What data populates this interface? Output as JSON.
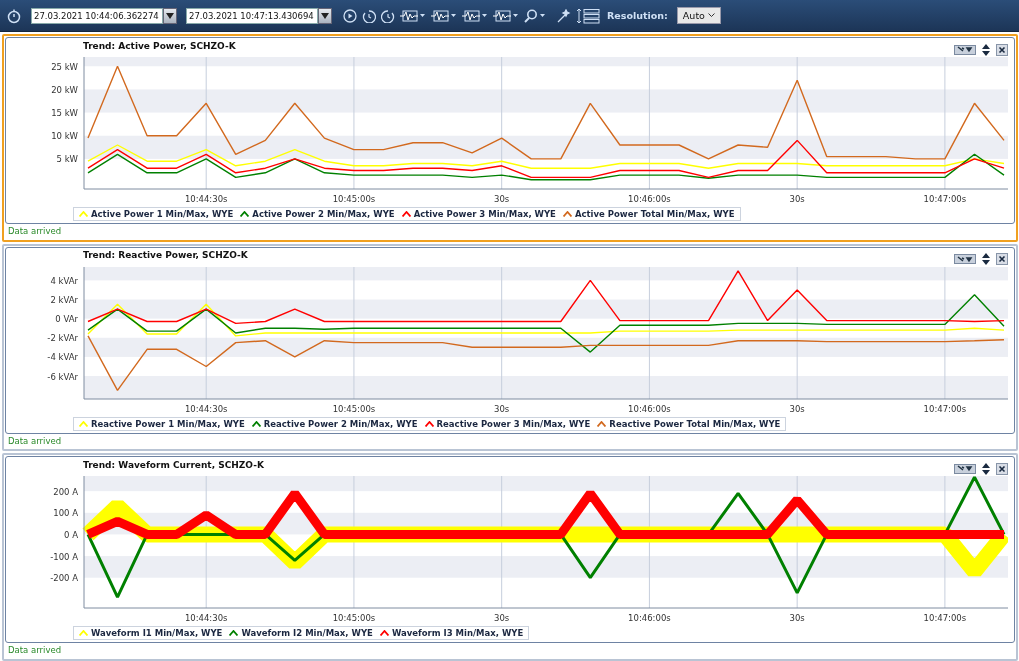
{
  "toolbar": {
    "start_time": "27.03.2021 10:44:06.362274",
    "end_time": "27.03.2021 10:47:13.430694",
    "resolution_label": "Resolution:",
    "resolution": "Auto"
  },
  "panels": [
    {
      "title": "Trend: Active Power, SCHZO-K",
      "selected": true,
      "kind": "trend",
      "status": "Data arrived",
      "chart_data": {
        "type": "line",
        "categories": [
          null,
          null,
          null,
          null,
          "10:44:30s",
          null,
          null,
          null,
          null,
          "10:45:00s",
          null,
          null,
          null,
          null,
          "30s",
          null,
          null,
          null,
          null,
          "10:46:00s",
          null,
          null,
          null,
          null,
          "30s",
          null,
          null,
          null,
          null,
          "10:47:00s",
          null,
          null
        ],
        "ylim": [
          -1.5,
          27
        ],
        "grid": true,
        "yticks": [
          {
            "value": 5,
            "label": "5 kW"
          },
          {
            "value": 10,
            "label": "10 kW"
          },
          {
            "value": 15,
            "label": "15 kW"
          },
          {
            "value": 20,
            "label": "20 kW"
          },
          {
            "value": 25,
            "label": "25 kW"
          }
        ],
        "series": [
          {
            "name": "Active Power 1 Min/Max, WYE",
            "color": "#ffff00",
            "values": [
              4.5,
              8,
              4.5,
              4.5,
              7,
              3.5,
              4.5,
              7,
              4.5,
              3.5,
              3.5,
              4,
              4,
              3.5,
              4.5,
              3,
              3,
              3,
              4,
              4,
              4,
              3,
              4,
              4,
              4,
              3.5,
              3.5,
              3.5,
              3.5,
              3.5,
              5,
              4
            ]
          },
          {
            "name": "Active Power 2 Min/Max, WYE",
            "color": "#008000",
            "values": [
              2,
              6,
              2,
              2,
              5,
              1,
              2,
              5,
              2,
              1.5,
              1.5,
              1.5,
              1.5,
              1,
              1.5,
              0.5,
              0.5,
              0.5,
              1.5,
              1.5,
              1.5,
              0.8,
              1.5,
              1.5,
              1.5,
              1,
              1,
              1,
              1,
              1,
              6,
              1.5
            ]
          },
          {
            "name": "Active Power 3 Min/Max, WYE",
            "color": "#ff0000",
            "values": [
              3,
              7,
              3,
              3,
              6,
              2,
              3,
              5,
              3,
              2.5,
              2.5,
              3,
              3,
              2.5,
              3.5,
              1,
              1,
              1,
              2.5,
              2.5,
              2.5,
              1,
              2.5,
              2.5,
              9,
              2,
              2,
              2,
              2,
              2,
              5,
              3
            ]
          },
          {
            "name": "Active Power Total Min/Max, WYE",
            "color": "#d2691e",
            "values": [
              9.5,
              25,
              10,
              10,
              17,
              6,
              9,
              17,
              9.5,
              7,
              7,
              8.5,
              8.5,
              6.3,
              9.5,
              5,
              5,
              17,
              8,
              8,
              8,
              5,
              8,
              7.5,
              22,
              5.5,
              5.5,
              5.5,
              5,
              5,
              17,
              9
            ]
          }
        ]
      }
    },
    {
      "title": "Trend: Reactive Power, SCHZO-K",
      "selected": false,
      "kind": "trend",
      "status": "Data arrived",
      "chart_data": {
        "type": "line",
        "categories": [
          null,
          null,
          null,
          null,
          "10:44:30s",
          null,
          null,
          null,
          null,
          "10:45:00s",
          null,
          null,
          null,
          null,
          "30s",
          null,
          null,
          null,
          null,
          "10:46:00s",
          null,
          null,
          null,
          null,
          "30s",
          null,
          null,
          null,
          null,
          "10:47:00s",
          null,
          null
        ],
        "ylim": [
          -8.4,
          5.4
        ],
        "grid": true,
        "yticks": [
          {
            "value": 4,
            "label": "4 kVAr"
          },
          {
            "value": 2,
            "label": "2 kVAr"
          },
          {
            "value": 0,
            "label": "0 VAr"
          },
          {
            "value": -2,
            "label": "-2 kVAr"
          },
          {
            "value": -4,
            "label": "-4 kVAr"
          },
          {
            "value": -6,
            "label": "-6 kVAr"
          }
        ],
        "series": [
          {
            "name": "Reactive Power 1 Min/Max, WYE",
            "color": "#ffff00",
            "values": [
              -1.6,
              1.5,
              -1.6,
              -1.6,
              1.5,
              -1.8,
              -1.5,
              -1.5,
              -1.5,
              -1.5,
              -1.5,
              -1.5,
              -1.5,
              -1.5,
              -1.5,
              -1.5,
              -1.5,
              -1.5,
              -1.3,
              -1.3,
              -1.3,
              -1.3,
              -1.2,
              -1.2,
              -1.2,
              -1.2,
              -1.2,
              -1.2,
              -1.2,
              -1.2,
              -1,
              -1.2
            ]
          },
          {
            "name": "Reactive Power 2 Min/Max, WYE",
            "color": "#008000",
            "values": [
              -1.2,
              1,
              -1.3,
              -1.3,
              1,
              -1.5,
              -1,
              -1,
              -1.1,
              -1,
              -1,
              -1,
              -1,
              -1,
              -1,
              -1,
              -1,
              -3.5,
              -0.7,
              -0.7,
              -0.7,
              -0.7,
              -0.5,
              -0.5,
              -0.5,
              -0.6,
              -0.6,
              -0.6,
              -0.6,
              -0.6,
              2.5,
              -0.8
            ]
          },
          {
            "name": "Reactive Power 3 Min/Max, WYE",
            "color": "#ff0000",
            "values": [
              -0.3,
              1,
              -0.3,
              -0.3,
              1,
              -0.5,
              -0.3,
              1,
              -0.3,
              -0.3,
              -0.3,
              -0.3,
              -0.3,
              -0.3,
              -0.3,
              -0.3,
              -0.3,
              4,
              -0.2,
              -0.2,
              -0.2,
              -0.2,
              5,
              -0.2,
              3,
              -0.2,
              -0.2,
              -0.2,
              -0.2,
              -0.2,
              -0.3,
              -0.2
            ]
          },
          {
            "name": "Reactive Power Total Min/Max, WYE",
            "color": "#d2691e",
            "values": [
              -1.8,
              -7.5,
              -3.2,
              -3.2,
              -5,
              -2.5,
              -2.3,
              -4,
              -2.3,
              -2.5,
              -2.5,
              -2.5,
              -2.5,
              -3,
              -3,
              -3,
              -3,
              -2.8,
              -2.8,
              -2.8,
              -2.8,
              -2.8,
              -2.3,
              -2.3,
              -2.3,
              -2.4,
              -2.4,
              -2.4,
              -2.4,
              -2.4,
              -2.3,
              -2.2
            ]
          }
        ]
      }
    },
    {
      "title": "Trend: Waveform Current, SCHZO-K",
      "selected": false,
      "kind": "envelope",
      "status": "Data arrived",
      "chart_data": {
        "type": "line",
        "categories": [
          null,
          null,
          null,
          null,
          "10:44:30s",
          null,
          null,
          null,
          null,
          "10:45:00s",
          null,
          null,
          null,
          null,
          "30s",
          null,
          null,
          null,
          null,
          "10:46:00s",
          null,
          null,
          null,
          null,
          "30s",
          null,
          null,
          null,
          null,
          "10:47:00s",
          null,
          null
        ],
        "ylim": [
          -340,
          270
        ],
        "grid": true,
        "yticks": [
          {
            "value": 200,
            "label": "200 A"
          },
          {
            "value": 100,
            "label": "100 A"
          },
          {
            "value": 0,
            "label": "0 A"
          },
          {
            "value": -100,
            "label": "-100 A"
          },
          {
            "value": -200,
            "label": "-200 A"
          }
        ],
        "series": [
          {
            "name": "Waveform I1 Min/Max, WYE",
            "color": "#ffff00",
            "values": [
              0,
              130,
              0,
              0,
              0,
              0,
              0,
              -130,
              0,
              0,
              0,
              0,
              0,
              0,
              0,
              0,
              0,
              0,
              0,
              0,
              0,
              0,
              0,
              0,
              0,
              0,
              0,
              0,
              0,
              0,
              -170,
              0
            ]
          },
          {
            "name": "Waveform I2 Min/Max, WYE",
            "color": "#008000",
            "values": [
              0,
              -290,
              0,
              0,
              0,
              0,
              0,
              -120,
              0,
              0,
              0,
              0,
              0,
              0,
              0,
              0,
              0,
              -200,
              0,
              0,
              0,
              0,
              190,
              0,
              -270,
              0,
              0,
              0,
              0,
              0,
              265,
              0
            ]
          },
          {
            "name": "Waveform I3 Min/Max, WYE",
            "color": "#ff0000",
            "values": [
              0,
              60,
              0,
              0,
              90,
              0,
              0,
              190,
              0,
              0,
              0,
              0,
              0,
              0,
              0,
              0,
              0,
              190,
              0,
              0,
              0,
              0,
              0,
              0,
              160,
              0,
              0,
              0,
              0,
              0,
              0,
              0
            ]
          }
        ]
      }
    }
  ]
}
